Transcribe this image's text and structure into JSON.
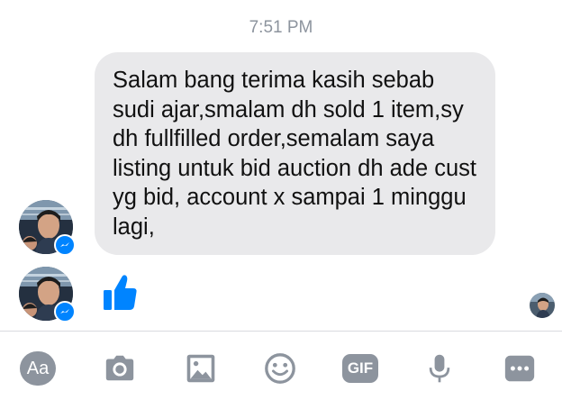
{
  "conversation": {
    "timestamp": "7:51 PM",
    "message": {
      "text": "Salam bang terima kasih sebab sudi ajar,smalam dh sold 1 item,sy dh fullfilled order,semalam saya listing untuk bid auction dh ade cust yg bid, account x sampai 1 minggu lagi,"
    },
    "reaction": "like-icon"
  },
  "composer": {
    "text_button_label": "Aa",
    "gif_label": "GIF",
    "icons": [
      "camera-icon",
      "gallery-icon",
      "emoji-icon",
      "microphone-icon",
      "more-icon"
    ]
  },
  "colors": {
    "bubble": "#e9e9eb",
    "accent": "#0084ff",
    "icon_gray": "#8d949e",
    "timestamp": "#8d949e"
  }
}
